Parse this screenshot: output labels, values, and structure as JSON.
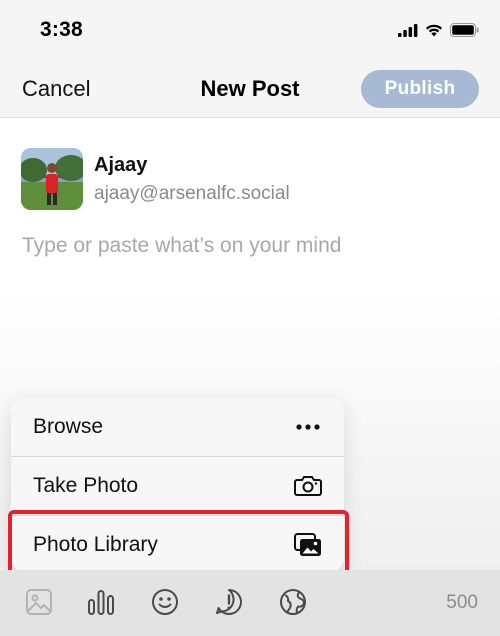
{
  "status_bar": {
    "time": "3:38",
    "icons": [
      "signal-icon",
      "wifi-icon",
      "battery-icon"
    ]
  },
  "nav": {
    "cancel_label": "Cancel",
    "title": "New Post",
    "publish_label": "Publish"
  },
  "author": {
    "name": "Ajaay",
    "handle": "ajaay@arsenalfc.social"
  },
  "composer": {
    "placeholder": "Type or paste what’s on your mind"
  },
  "attachment_menu": {
    "items": [
      {
        "label": "Browse",
        "icon": "ellipsis-icon"
      },
      {
        "label": "Take Photo",
        "icon": "camera-icon"
      },
      {
        "label": "Photo Library",
        "icon": "photo-library-icon",
        "highlighted": true
      }
    ]
  },
  "toolbar": {
    "icons": [
      "image-icon",
      "poll-icon",
      "emoji-icon",
      "content-warning-icon",
      "visibility-globe-icon"
    ],
    "char_count": "500"
  },
  "colors": {
    "publish_disabled": "#a7b9d3",
    "highlight_border": "#e8202a",
    "toolbar_bg": "#e3e3e3"
  }
}
